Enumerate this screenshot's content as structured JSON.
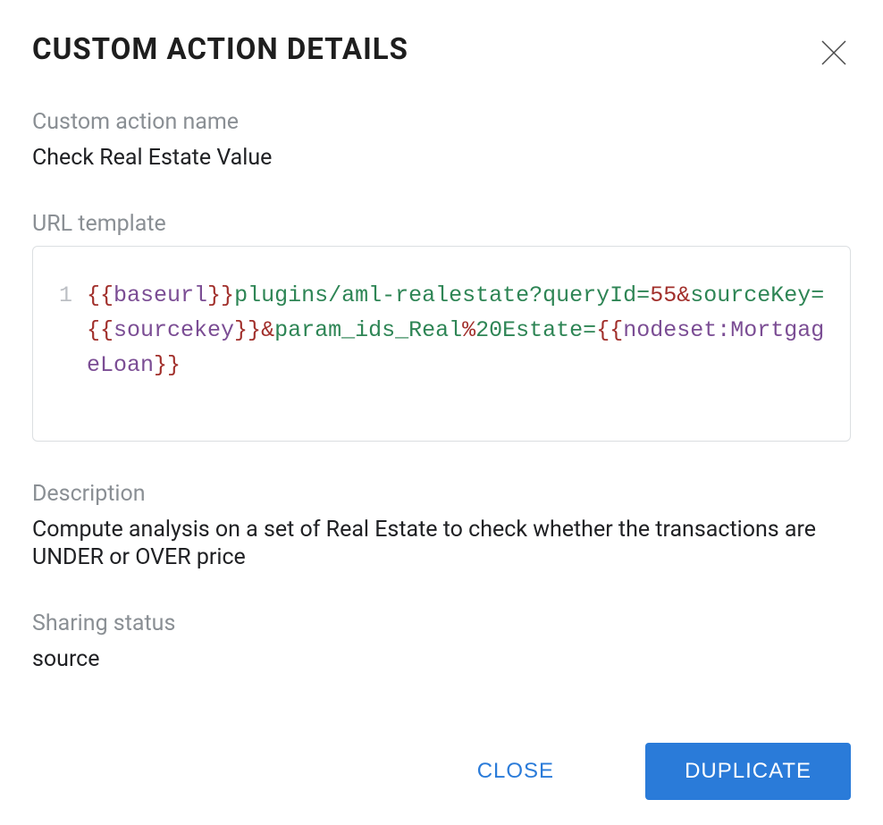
{
  "header": {
    "title": "CUSTOM ACTION DETAILS"
  },
  "fields": {
    "name_label": "Custom action name",
    "name_value": "Check Real Estate Value",
    "url_label": "URL template",
    "url_template": {
      "line_number": "1",
      "tokens": [
        {
          "text": "{{",
          "cls": "tok-brace"
        },
        {
          "text": "baseurl",
          "cls": "tok-var"
        },
        {
          "text": "}}",
          "cls": "tok-brace"
        },
        {
          "text": "plugins/aml",
          "cls": "tok-path"
        },
        {
          "text": "-",
          "cls": "tok-punct"
        },
        {
          "text": "realestate?",
          "cls": "tok-key"
        },
        {
          "text": "queryId",
          "cls": "tok-key"
        },
        {
          "text": "=",
          "cls": "tok-punct"
        },
        {
          "text": "55",
          "cls": "tok-num"
        },
        {
          "text": "&",
          "cls": "tok-pct"
        },
        {
          "text": "sourceKey",
          "cls": "tok-key"
        },
        {
          "text": "=",
          "cls": "tok-punct"
        },
        {
          "text": "{{",
          "cls": "tok-brace"
        },
        {
          "text": "sourcekey",
          "cls": "tok-var"
        },
        {
          "text": "}}",
          "cls": "tok-brace"
        },
        {
          "text": "&",
          "cls": "tok-pct"
        },
        {
          "text": "param_ids_Real",
          "cls": "tok-key"
        },
        {
          "text": "%",
          "cls": "tok-pct"
        },
        {
          "text": "20Estate",
          "cls": "tok-key"
        },
        {
          "text": "=",
          "cls": "tok-punct"
        },
        {
          "text": "{{",
          "cls": "tok-brace"
        },
        {
          "text": "nodeset:MortgageLoan",
          "cls": "tok-var"
        },
        {
          "text": "}}",
          "cls": "tok-brace"
        }
      ]
    },
    "description_label": "Description",
    "description_value": "Compute analysis on a set of Real Estate to check whether the transactions are UNDER or OVER price",
    "sharing_label": "Sharing status",
    "sharing_value": "source"
  },
  "footer": {
    "close_label": "CLOSE",
    "duplicate_label": "DUPLICATE"
  }
}
